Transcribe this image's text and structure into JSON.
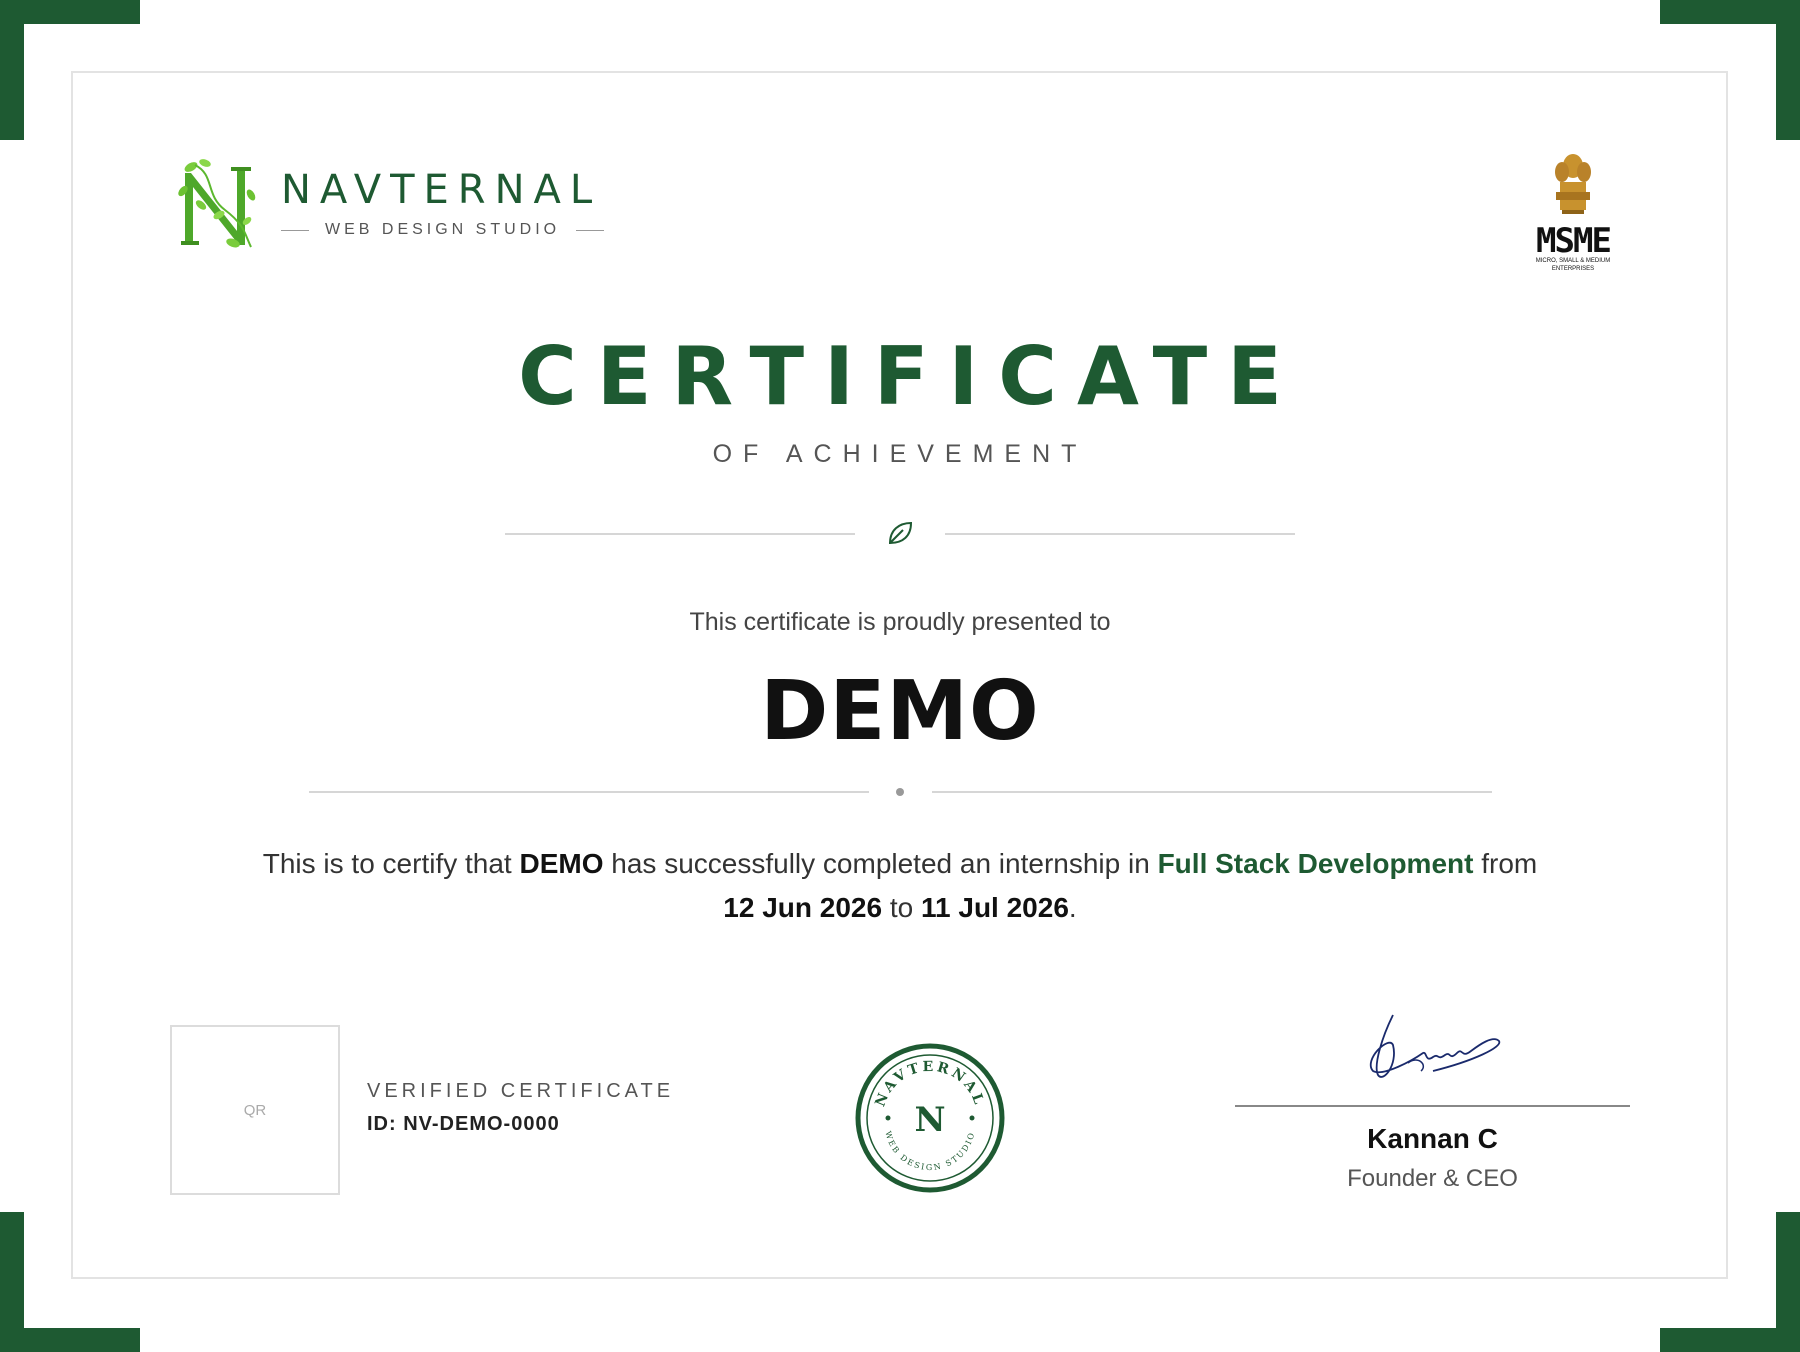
{
  "brand": {
    "name": "NAVTERNAL",
    "tagline": "WEB DESIGN STUDIO",
    "logo_icon": "leafy-n-logo-icon"
  },
  "partner_logo": {
    "icon": "msme-emblem-icon",
    "word": "MSME",
    "small_text": "MICRO, SMALL & MEDIUM ENTERPRISES"
  },
  "certificate": {
    "title": "CERTIFICATE",
    "subtitle": "OF ACHIEVEMENT",
    "presented_text": "This certificate is proudly presented to",
    "recipient": "DEMO",
    "statement": {
      "part1": "This is to certify that",
      "name": "DEMO",
      "part2": "has successfully completed an internship in",
      "course": "Full Stack Development",
      "part3": "from",
      "start_date": "12 Jun 2026",
      "part4": "to",
      "end_date": "11 Jul 2026",
      "end": "."
    }
  },
  "verification": {
    "qr_placeholder": "QR",
    "label": "VERIFIED CERTIFICATE",
    "id": "ID: NV-DEMO-0000"
  },
  "seal": {
    "letter": "N",
    "top_text": "NAVTERNAL",
    "bottom_text": "WEB DESIGN STUDIO"
  },
  "signatory": {
    "name": "Kannan C",
    "role": "Founder & CEO"
  },
  "colors": {
    "brand_green": "#1e5a32",
    "leaf_green": "#5cb82e",
    "text_dark": "#111111"
  }
}
